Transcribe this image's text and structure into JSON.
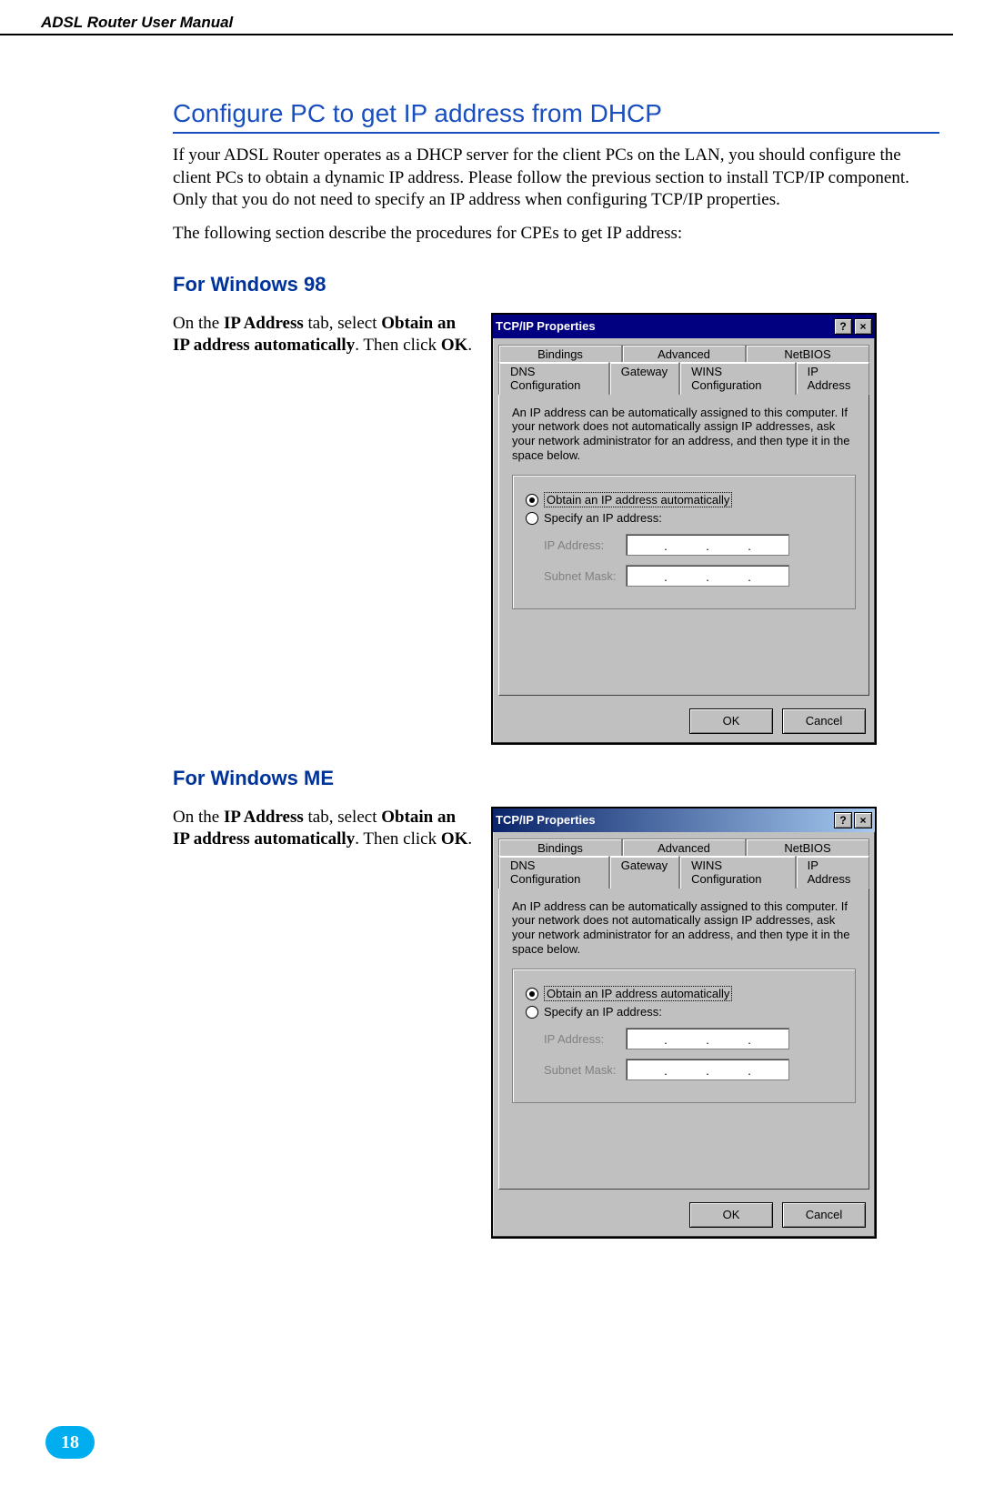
{
  "header": {
    "title": "ADSL Router User Manual"
  },
  "headings": {
    "main": "Configure PC to get IP address from DHCP",
    "win98": "For Windows 98",
    "winme": "For Windows ME"
  },
  "paragraphs": {
    "p1": "If your ADSL Router operates as a DHCP server for the client PCs on the LAN, you should configure the client PCs to obtain a dynamic IP address. Please follow the previous section to install TCP/IP component. Only that you do not need to specify an IP address when configuring TCP/IP properties.",
    "p2": "The following section describe the procedures for CPEs to get IP address:"
  },
  "instruction": {
    "prefix": "On the ",
    "b1": "IP Address",
    "mid1": " tab, select ",
    "b2": "Obtain an IP address automatically",
    "mid2": ". Then click ",
    "b3": "OK",
    "suffix": "."
  },
  "dialog": {
    "title": "TCP/IP Properties",
    "help_glyph": "?",
    "close_glyph": "×",
    "tabs_row1": [
      "Bindings",
      "Advanced",
      "NetBIOS"
    ],
    "tabs_row2": [
      "DNS Configuration",
      "Gateway",
      "WINS Configuration",
      "IP Address"
    ],
    "desc": "An IP address can be automatically assigned to this computer. If your network does not automatically assign IP addresses, ask your network administrator for an address, and then type it in the space below.",
    "radio_obtain": "Obtain an IP address automatically",
    "radio_specify": "Specify an IP address:",
    "ip_label": "IP Address:",
    "subnet_label": "Subnet Mask:",
    "ok": "OK",
    "cancel": "Cancel"
  },
  "page_number": "18"
}
